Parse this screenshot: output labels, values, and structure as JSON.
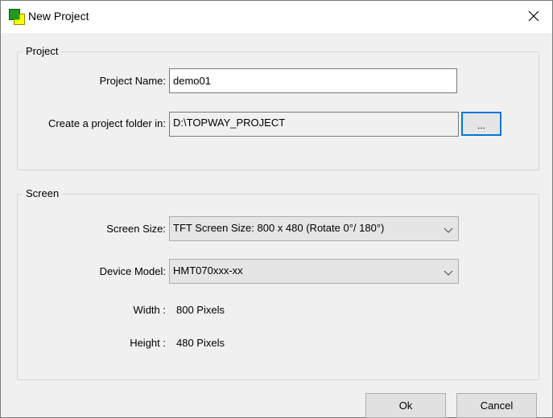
{
  "window": {
    "title": "New Project"
  },
  "project_group": {
    "legend": "Project",
    "name_label": "Project Name:",
    "name_value": "demo01",
    "folder_label": "Create a project folder in:",
    "folder_value": "D:\\TOPWAY_PROJECT",
    "browse_label": "..."
  },
  "screen_group": {
    "legend": "Screen",
    "size_label": "Screen Size:",
    "size_value": "TFT Screen Size: 800 x 480 (Rotate 0°/ 180°)",
    "model_label": "Device Model:",
    "model_value": "HMT070xxx-xx",
    "width_label": "Width :",
    "width_value": "800 Pixels",
    "height_label": "Height :",
    "height_value": "480 Pixels"
  },
  "buttons": {
    "ok": "Ok",
    "cancel": "Cancel"
  },
  "icons": {
    "app": "project-app-icon",
    "close": "close-icon",
    "dropdown": "chevron-down-icon"
  },
  "colors": {
    "focus": "#0078d7",
    "icon_green": "#1f9a1f",
    "icon_yellow": "#ffff00"
  }
}
